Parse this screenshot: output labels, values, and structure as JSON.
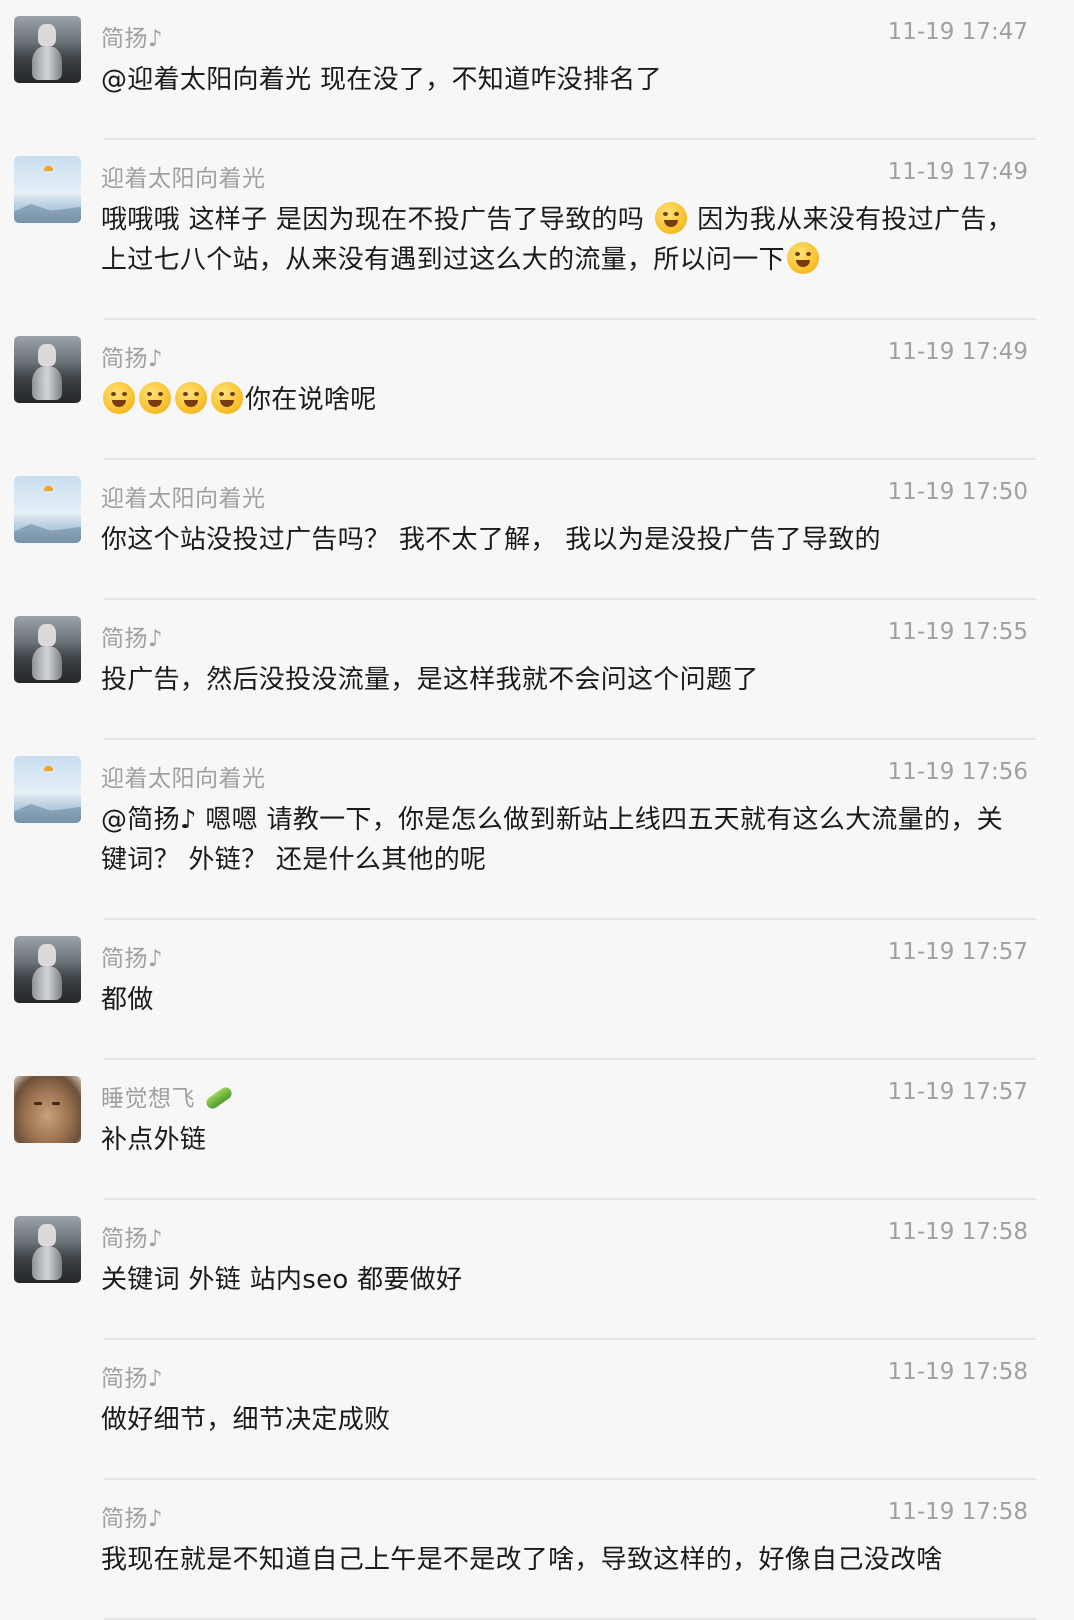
{
  "messages": [
    {
      "sender": "简扬♪",
      "time": "11-19 17:47",
      "avatar": "cat-tiger-reflection-avatar",
      "show_avatar": true,
      "text_parts": [
        "@迎着太阳向着光 现在没了，不知道咋没排名了"
      ]
    },
    {
      "sender": "迎着太阳向着光",
      "time": "11-19 17:49",
      "avatar": "sky-parachute-avatar",
      "show_avatar": true,
      "text_parts": [
        "哦哦哦 这样子 是因为现在不投广告了导致的吗 ",
        {
          "emoji": "tears-of-joy-emoji"
        },
        " 因为我从来没有投过广告，上过七八个站，从来没有遇到过这么大的流量，所以问一下",
        {
          "emoji": "pleading-face-emoji"
        }
      ]
    },
    {
      "sender": "简扬♪",
      "time": "11-19 17:49",
      "avatar": "cat-tiger-reflection-avatar",
      "show_avatar": true,
      "text_parts": [
        {
          "emoji": "rolling-laughing-emoji"
        },
        {
          "emoji": "rolling-laughing-emoji"
        },
        {
          "emoji": "rolling-laughing-emoji"
        },
        {
          "emoji": "crying-emoji"
        },
        "你在说啥呢"
      ]
    },
    {
      "sender": "迎着太阳向着光",
      "time": "11-19 17:50",
      "avatar": "sky-parachute-avatar",
      "show_avatar": true,
      "text_parts": [
        "你这个站没投过广告吗？ 我不太了解， 我以为是没投广告了导致的"
      ]
    },
    {
      "sender": "简扬♪",
      "time": "11-19 17:55",
      "avatar": "cat-tiger-reflection-avatar",
      "show_avatar": true,
      "text_parts": [
        "投广告，然后没投没流量，是这样我就不会问这个问题了"
      ]
    },
    {
      "sender": "迎着太阳向着光",
      "time": "11-19 17:56",
      "avatar": "sky-parachute-avatar",
      "show_avatar": true,
      "text_parts": [
        "@简扬♪ 嗯嗯 请教一下，你是怎么做到新站上线四五天就有这么大流量的，关键词？ 外链？ 还是什么其他的呢"
      ]
    },
    {
      "sender": "简扬♪",
      "time": "11-19 17:57",
      "avatar": "cat-tiger-reflection-avatar",
      "show_avatar": true,
      "text_parts": [
        "都做"
      ]
    },
    {
      "sender": "睡觉想飞",
      "sender_emoji": "cucumber-emoji",
      "time": "11-19 17:57",
      "avatar": "sleeping-cat-avatar",
      "show_avatar": true,
      "text_parts": [
        "补点外链"
      ]
    },
    {
      "sender": "简扬♪",
      "time": "11-19 17:58",
      "avatar": "cat-tiger-reflection-avatar",
      "show_avatar": true,
      "text_parts": [
        "关键词 外链 站内seo 都要做好"
      ]
    },
    {
      "sender": "简扬♪",
      "time": "11-19 17:58",
      "avatar": "cat-tiger-reflection-avatar",
      "show_avatar": false,
      "text_parts": [
        "做好细节，细节决定成败"
      ]
    },
    {
      "sender": "简扬♪",
      "time": "11-19 17:58",
      "avatar": "cat-tiger-reflection-avatar",
      "show_avatar": false,
      "text_parts": [
        "我现在就是不知道自己上午是不是改了啥，导致这样的，好像自己没改啥"
      ]
    }
  ]
}
